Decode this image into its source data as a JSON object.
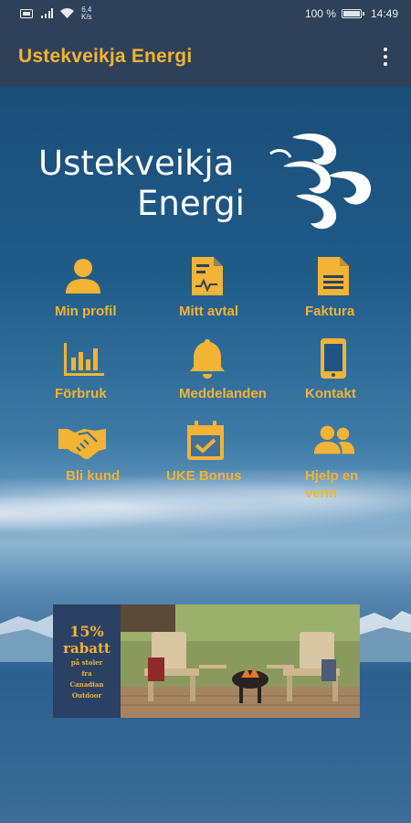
{
  "status": {
    "net_speed": "6,4\nK/s",
    "battery_pct": "100 %",
    "time": "14:49"
  },
  "app_bar": {
    "title": "Ustekveikja Energi",
    "menu_icon": "more-vert-icon"
  },
  "logo": {
    "line1": "Ustekveikja",
    "line2": "Energi"
  },
  "tiles": [
    {
      "label": "Min profil",
      "icon": "person-icon"
    },
    {
      "label": "Mitt avtal",
      "icon": "contract-icon"
    },
    {
      "label": "Faktura",
      "icon": "invoice-icon"
    },
    {
      "label": "Förbruk",
      "icon": "bar-chart-icon"
    },
    {
      "label": "Meddelanden",
      "icon": "bell-icon"
    },
    {
      "label": "Kontakt",
      "icon": "phone-icon"
    },
    {
      "label": "Bli kund",
      "icon": "handshake-icon"
    },
    {
      "label": "UKE Bonus",
      "icon": "calendar-check-icon"
    },
    {
      "label": "Hjelp en venn",
      "icon": "people-icon"
    }
  ],
  "banner": {
    "percent": "15%",
    "rabatt": "rabatt",
    "line1": "på stoler",
    "line2": "fra",
    "line3": "Canadian",
    "line4": "Outdoor"
  },
  "colors": {
    "accent": "#f3b335",
    "appbar": "#2f4158"
  }
}
